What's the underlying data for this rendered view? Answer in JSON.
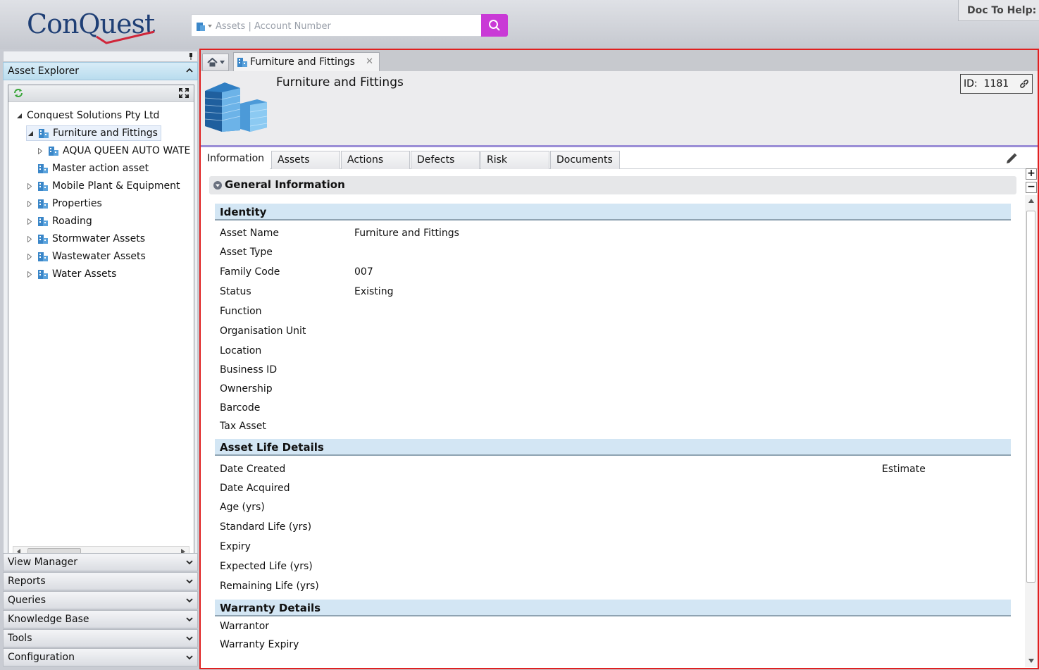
{
  "app": {
    "logo_text": "ConQuest",
    "doc_to_help": "Doc To Help:"
  },
  "search": {
    "placeholder": "Assets | Account Number",
    "value": ""
  },
  "left_panel": {
    "explorer_title": "Asset Explorer",
    "tree": [
      {
        "label": "Conquest Solutions Pty Ltd",
        "level": 0,
        "expanded": true,
        "icon": "none"
      },
      {
        "label": "Furniture and Fittings",
        "level": 1,
        "expanded": true,
        "selected": true,
        "icon": "building-icon"
      },
      {
        "label": "AQUA QUEEN AUTO WATE",
        "level": 2,
        "expanded": false,
        "icon": "building-icon"
      },
      {
        "label": "Master action asset",
        "level": 1,
        "icon": "building-icon"
      },
      {
        "label": "Mobile Plant & Equipment",
        "level": 1,
        "expanded": false,
        "icon": "building-icon"
      },
      {
        "label": "Properties",
        "level": 1,
        "expanded": false,
        "icon": "building-icon"
      },
      {
        "label": "Roading",
        "level": 1,
        "expanded": false,
        "icon": "building-icon"
      },
      {
        "label": "Stormwater Assets",
        "level": 1,
        "expanded": false,
        "icon": "building-icon"
      },
      {
        "label": "Wastewater Assets",
        "level": 1,
        "expanded": false,
        "icon": "building-icon"
      },
      {
        "label": "Water Assets",
        "level": 1,
        "expanded": false,
        "icon": "building-icon"
      }
    ],
    "accordion": [
      "View Manager",
      "Reports",
      "Queries",
      "Knowledge Base",
      "Tools",
      "Configuration"
    ]
  },
  "main": {
    "tab_label": "Furniture and Fittings",
    "asset_title": "Furniture and Fittings",
    "id_label": "ID:",
    "id_value": "1181",
    "subtabs": [
      "Information",
      "Assets",
      "Actions",
      "Defects",
      "Risk",
      "Documents"
    ],
    "active_subtab": "Information",
    "section_title": "General Information",
    "groups": {
      "identity": {
        "title": "Identity",
        "fields": [
          {
            "label": "Asset Name",
            "value": "Furniture and Fittings"
          },
          {
            "label": "Asset Type",
            "value": ""
          },
          {
            "label": "Family Code",
            "value": "007"
          },
          {
            "label": "Status",
            "value": "Existing"
          },
          {
            "label": "Function",
            "value": ""
          },
          {
            "label": "Organisation Unit",
            "value": ""
          },
          {
            "label": "Location",
            "value": ""
          },
          {
            "label": "Business ID",
            "value": ""
          },
          {
            "label": "Ownership",
            "value": ""
          },
          {
            "label": "Barcode",
            "value": ""
          },
          {
            "label": "Tax Asset",
            "value": ""
          }
        ]
      },
      "life": {
        "title": "Asset Life Details",
        "estimate_label": "Estimate",
        "fields": [
          {
            "label": "Date Created",
            "value": ""
          },
          {
            "label": "Date Acquired",
            "value": ""
          },
          {
            "label": "Age (yrs)",
            "value": ""
          },
          {
            "label": "Standard Life (yrs)",
            "value": ""
          },
          {
            "label": "Expiry",
            "value": ""
          },
          {
            "label": "Expected Life (yrs)",
            "value": ""
          },
          {
            "label": "Remaining Life (yrs)",
            "value": ""
          }
        ]
      },
      "warranty": {
        "title": "Warranty Details",
        "fields": [
          {
            "label": "Warrantor",
            "value": ""
          },
          {
            "label": "Warranty Expiry",
            "value": ""
          }
        ]
      }
    }
  },
  "colors": {
    "accent": "#c93ad6",
    "brand": "#1f3f75",
    "highlight_border": "#e02020"
  }
}
